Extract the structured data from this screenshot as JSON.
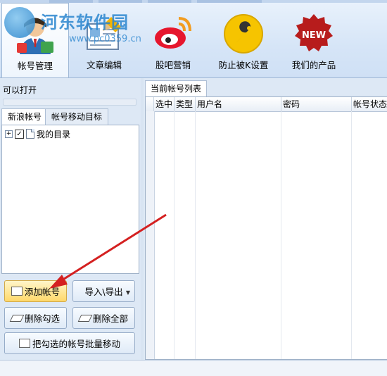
{
  "watermark": {
    "site_name": "河东软件园",
    "url": "www.pc0359.cn"
  },
  "ribbon": {
    "buttons": [
      {
        "label": "帐号管理",
        "icon": "account-manage-icon",
        "active": true
      },
      {
        "label": "文章编辑",
        "icon": "article-edit-icon",
        "active": false
      },
      {
        "label": "股吧营销",
        "icon": "weibo-icon",
        "active": false
      },
      {
        "label": "防止被K设置",
        "icon": "wrench-icon",
        "active": false
      },
      {
        "label": "我们的产品",
        "icon": "new-badge-icon",
        "active": false
      }
    ],
    "new_badge_text": "NEW"
  },
  "left": {
    "caption": "可以打开",
    "tabs": [
      "新浪帐号",
      "帐号移动目标"
    ],
    "tree": {
      "expander": "+",
      "checked": true,
      "label": "我的目录"
    },
    "buttons": {
      "add": "添加帐号",
      "import_export": "导入\\导出",
      "delete_checked": "删除勾选",
      "delete_all": "删除全部",
      "batch_move": "把勾选的帐号批量移动"
    }
  },
  "right": {
    "tab": "当前帐号列表",
    "columns": [
      "选中",
      "类型",
      "用户名",
      "密码",
      "帐号状态"
    ]
  },
  "colors": {
    "accent": "#1f7ec8",
    "arrow": "#d42020",
    "add_button": "#ffd86a"
  }
}
